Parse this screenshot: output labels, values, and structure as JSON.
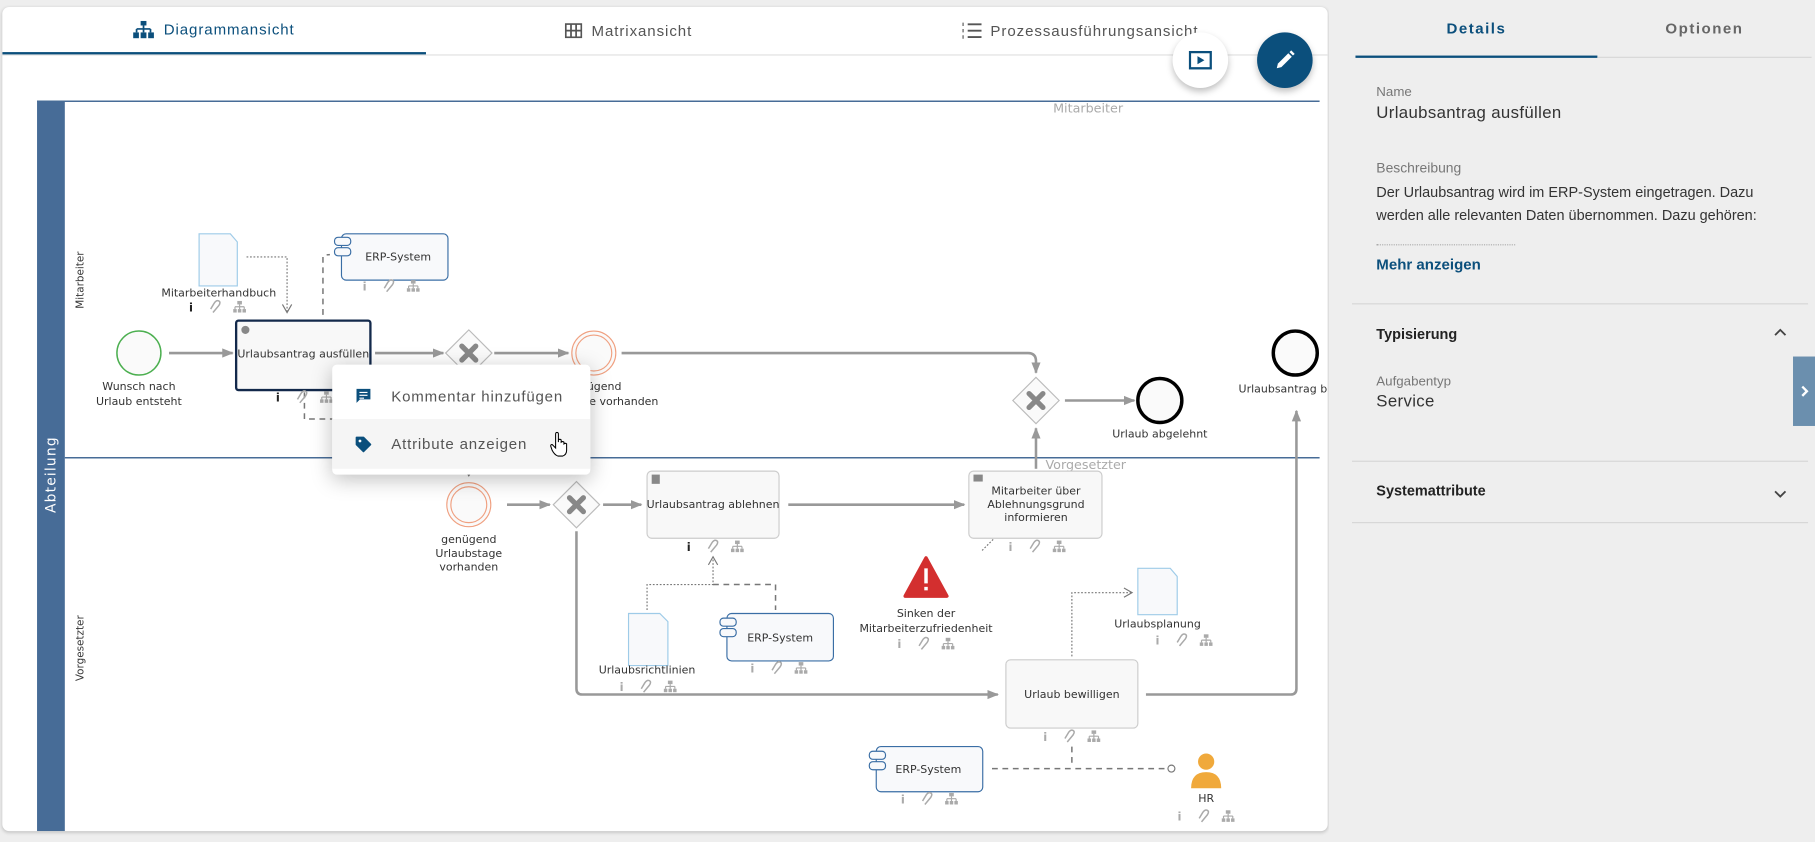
{
  "tabs": [
    {
      "label": "Diagrammansicht",
      "icon": "sitemap-icon",
      "active": true
    },
    {
      "label": "Matrixansicht",
      "icon": "grid-icon",
      "active": false
    },
    {
      "label": "Prozessausführungsansicht",
      "icon": "numbered-list-icon",
      "active": false
    }
  ],
  "fabs": {
    "play": "play-icon",
    "edit": "pencil-icon"
  },
  "diagram": {
    "pool": "Abteilung",
    "lanes": [
      "Mitarbeiter",
      "Vorgesetzter"
    ],
    "elements": {
      "start": [
        "Wunsch nach",
        "Urlaub entsteht"
      ],
      "task_fill": "Urlaubsantrag ausfüllen",
      "doc_handbook": "Mitarbeiterhandbuch",
      "erp": "ERP-System",
      "int_event_top": [
        "genügend",
        "Urlaubstage vorhanden"
      ],
      "end_rejected": "Urlaub abgelehnt",
      "end_approved": "Urlaubsantrag be",
      "int_event_bottom": [
        "genügend",
        "Urlaubstage",
        "vorhanden"
      ],
      "task_reject": "Urlaubsantrag ablehnen",
      "task_inform": [
        "Mitarbeiter über",
        "Ablehnungsgrund",
        "informieren"
      ],
      "risk": [
        "Sinken der",
        "Mitarbeiterzufriedenheit"
      ],
      "doc_guidelines": "Urlaubsrichtlinien",
      "doc_planning": "Urlaubsplanung",
      "task_approve": "Urlaub bewilligen",
      "role": "HR"
    }
  },
  "context_menu": [
    {
      "label": "Kommentar hinzufügen",
      "icon": "comment-icon"
    },
    {
      "label": "Attribute anzeigen",
      "icon": "tag-icon",
      "hovered": true
    }
  ],
  "panel": {
    "tabs": [
      "Details",
      "Optionen"
    ],
    "name_label": "Name",
    "name_value": "Urlaubsantrag ausfüllen",
    "desc_label": "Beschreibung",
    "desc_text": "Der Urlaubsantrag wird im ERP-System eingetragen. Dazu werden alle relevanten Daten übernommen. Dazu gehören:",
    "more": "Mehr anzeigen",
    "typ_section": "Typisierung",
    "task_type_label": "Aufgabentyp",
    "task_type_value": "Service",
    "sys_section": "Systemattribute"
  },
  "colors": {
    "accent": "#0b4f7c",
    "pool": "#476c97",
    "start": "#4caf50",
    "intermediate": "#f0a080",
    "risk": "#d32f2f",
    "role": "#f0a93b"
  }
}
